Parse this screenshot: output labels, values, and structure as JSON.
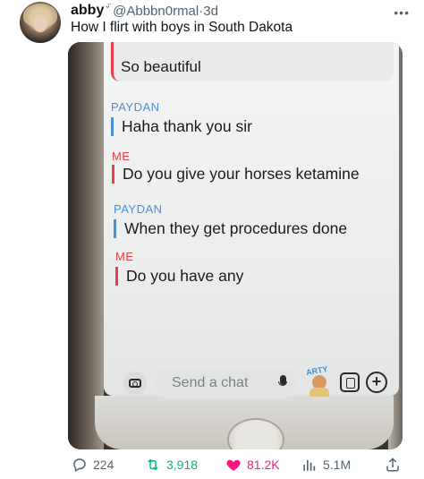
{
  "tweet": {
    "display_name": "abby",
    "name_badge": "ᵕ̈",
    "handle": "@Abbbn0rmal",
    "separator": "·",
    "age": "3d",
    "text": "How I flirt with boys in South Dakota"
  },
  "photo": {
    "messages": [
      {
        "sender": "",
        "text": "So beautiful",
        "color": "#e1424a"
      },
      {
        "sender": "PAYDAN",
        "text": "Haha thank you sir",
        "color": "#4d8fd6"
      },
      {
        "sender": "ME",
        "text": "Do you give your horses ketamine",
        "color": "#e1424a"
      },
      {
        "sender": "PAYDAN",
        "text": "When they get procedures done",
        "color": "#4d8fd6"
      },
      {
        "sender": "ME",
        "text": "Do you have any",
        "color": "#e1424a"
      }
    ],
    "chat_placeholder": "Send a chat",
    "bitmoji_tag": "ARTY"
  },
  "actions": {
    "replies": "224",
    "retweets": "3,918",
    "likes": "81.2K",
    "views": "5.1M"
  },
  "colors": {
    "paydan": "#4d8fd6",
    "me": "#e1424a",
    "like": "#f91880",
    "retweet": "#00ba7c",
    "muted": "#536471"
  }
}
